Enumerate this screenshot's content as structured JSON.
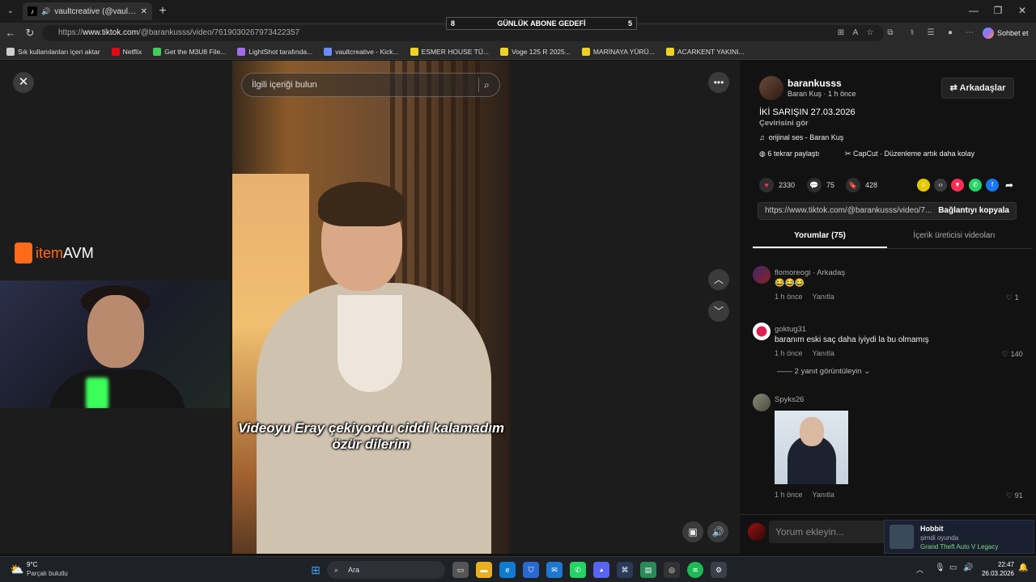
{
  "browser": {
    "tab_title": "vaultcreative (@vaultcreative)",
    "url_prefix": "https://",
    "url_domain": "www.tiktok.com",
    "url_path": "/@barankusss/video/7619030267973422357",
    "copilot_label": "Sohbet et"
  },
  "overlay_goal": {
    "left": "8",
    "title": "GÜNLÜK ABONE GEDEFİ",
    "right": "5"
  },
  "bookmarks": [
    {
      "label": "Sık kullanılanları içeri aktar",
      "color": "#cfcfcf"
    },
    {
      "label": "Netflix",
      "color": "#e50914"
    },
    {
      "label": "Get the M3U8 File...",
      "color": "#3ecf5a"
    },
    {
      "label": "LightShot tarafında...",
      "color": "#a36bf0"
    },
    {
      "label": "vaultcreative - Kick...",
      "color": "#6a8cff"
    },
    {
      "label": "ESMER HOUSE TÜ...",
      "color": "#f0d020"
    },
    {
      "label": "Voge 125 R 2025...",
      "color": "#f0d020"
    },
    {
      "label": "MARİNAYA YÜRÜ...",
      "color": "#f0d020"
    },
    {
      "label": "ACARKENT YAKINI...",
      "color": "#f0d020"
    }
  ],
  "player": {
    "search_placeholder": "İlgili içeriği bulun",
    "caption": "Videoyu Eray çekiyordu ciddi kalamadım özür dilerim",
    "overlay_logo_item": "item",
    "overlay_logo_avm": "AVM"
  },
  "author": {
    "username": "barankusss",
    "display": "Baran Kuş · 1 h önce",
    "follow_label": "Arkadaşlar",
    "title": "İKİ SARIŞIN 27.03.2026",
    "translate": "Çevirisini gör",
    "sound": "orijinal ses - Baran Kuş",
    "reposts": "6 tekrar paylaştı",
    "capcut": "CapCut · Düzenleme artık daha kolay"
  },
  "stats": {
    "likes": "2330",
    "comments": "75",
    "saves": "428"
  },
  "link": {
    "url": "https://www.tiktok.com/@barankusss/video/7...",
    "copy_label": "Bağlantıyı kopyala"
  },
  "tabs": {
    "comments": "Yorumlar (75)",
    "creator": "İçerik üreticisi videoları"
  },
  "comments": [
    {
      "name": "flomoreogi",
      "tag": " · Arkadaş",
      "text": "😂😂😂",
      "time": "1 h önce",
      "reply": "Yanıtla",
      "likes": "1"
    },
    {
      "name": "goktug31",
      "tag": "",
      "text": "baranım eski saç daha iyiydi la bu olmamış",
      "time": "1 h önce",
      "reply": "Yanıtla",
      "likes": "140",
      "view_replies": "2 yanıt görüntüleyin"
    },
    {
      "name": "Spyks26",
      "tag": "",
      "text": "",
      "time": "1 h önce",
      "reply": "Yanıtla",
      "likes": "91"
    }
  ],
  "comment_input_placeholder": "Yorum ekleyin...",
  "toast": {
    "name": "Hobbit",
    "status": "şimdi oyunda",
    "game": "Grand Theft Auto V Legacy"
  },
  "taskbar": {
    "weather_temp": "9°C",
    "weather_desc": "Parçalı bulutlu",
    "search": "Ara",
    "time": "22:47",
    "date": "26.03.2026"
  }
}
